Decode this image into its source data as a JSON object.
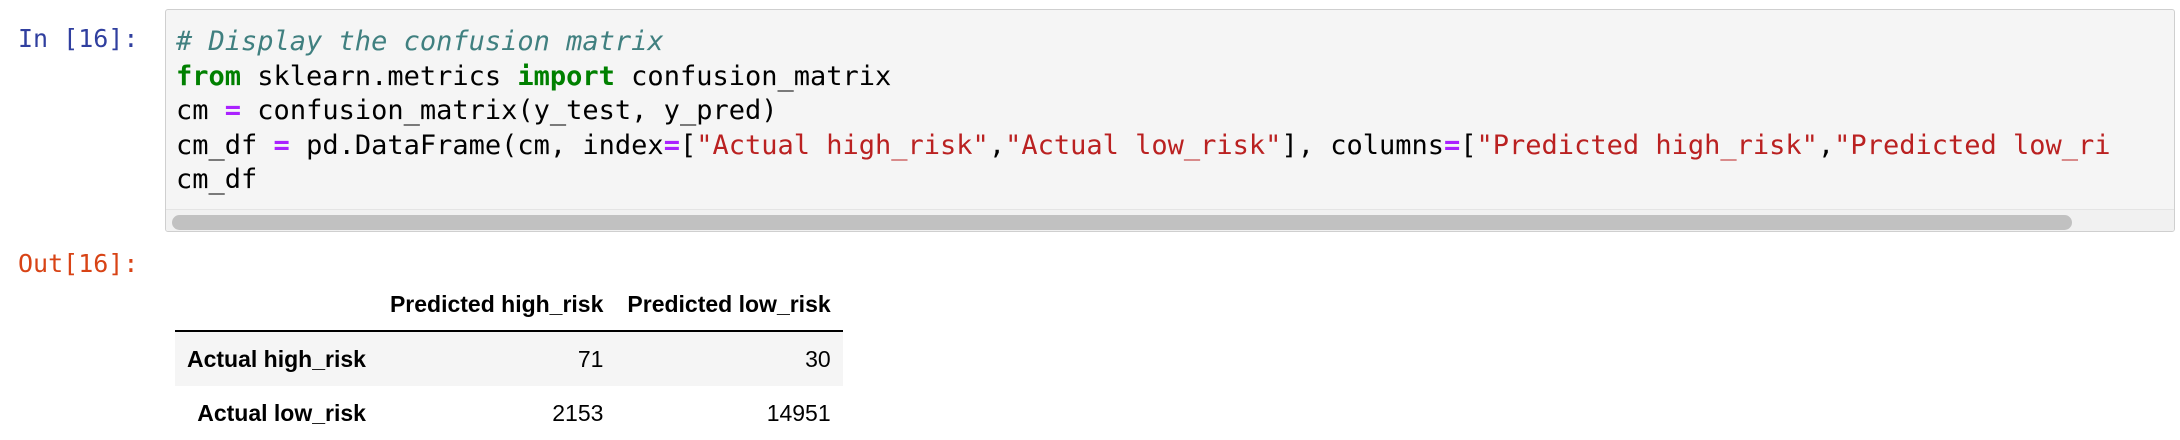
{
  "input_cell": {
    "prompt": "In [16]:",
    "code_lines": [
      [
        {
          "t": "comment",
          "v": "# Display the confusion matrix"
        }
      ],
      [
        {
          "t": "keyword",
          "v": "from"
        },
        {
          "t": "plain",
          "v": " sklearn.metrics "
        },
        {
          "t": "keyword",
          "v": "import"
        },
        {
          "t": "plain",
          "v": " confusion_matrix"
        }
      ],
      [
        {
          "t": "plain",
          "v": "cm "
        },
        {
          "t": "op",
          "v": "="
        },
        {
          "t": "plain",
          "v": " confusion_matrix(y_test, y_pred)"
        }
      ],
      [
        {
          "t": "plain",
          "v": "cm_df "
        },
        {
          "t": "op",
          "v": "="
        },
        {
          "t": "plain",
          "v": " pd.DataFrame(cm, index"
        },
        {
          "t": "op",
          "v": "="
        },
        {
          "t": "plain",
          "v": "["
        },
        {
          "t": "string",
          "v": "\"Actual high_risk\""
        },
        {
          "t": "plain",
          "v": ","
        },
        {
          "t": "string",
          "v": "\"Actual low_risk\""
        },
        {
          "t": "plain",
          "v": "], columns"
        },
        {
          "t": "op",
          "v": "="
        },
        {
          "t": "plain",
          "v": "["
        },
        {
          "t": "string",
          "v": "\"Predicted high_risk\""
        },
        {
          "t": "plain",
          "v": ","
        },
        {
          "t": "string",
          "v": "\"Predicted low_ri"
        }
      ],
      [
        {
          "t": "plain",
          "v": "cm_df"
        }
      ]
    ]
  },
  "output_cell": {
    "prompt": "Out[16]:",
    "table": {
      "corner": "",
      "columns": [
        "Predicted high_risk",
        "Predicted low_risk"
      ],
      "rows": [
        {
          "index": "Actual high_risk",
          "values": [
            "71",
            "30"
          ]
        },
        {
          "index": "Actual low_risk",
          "values": [
            "2153",
            "14951"
          ]
        }
      ]
    }
  },
  "colors": {
    "prompt_in": "#303f9f",
    "prompt_out": "#d84315",
    "comment": "#408080",
    "keyword": "#008000",
    "operator": "#aa22ff",
    "string": "#ba2121"
  }
}
